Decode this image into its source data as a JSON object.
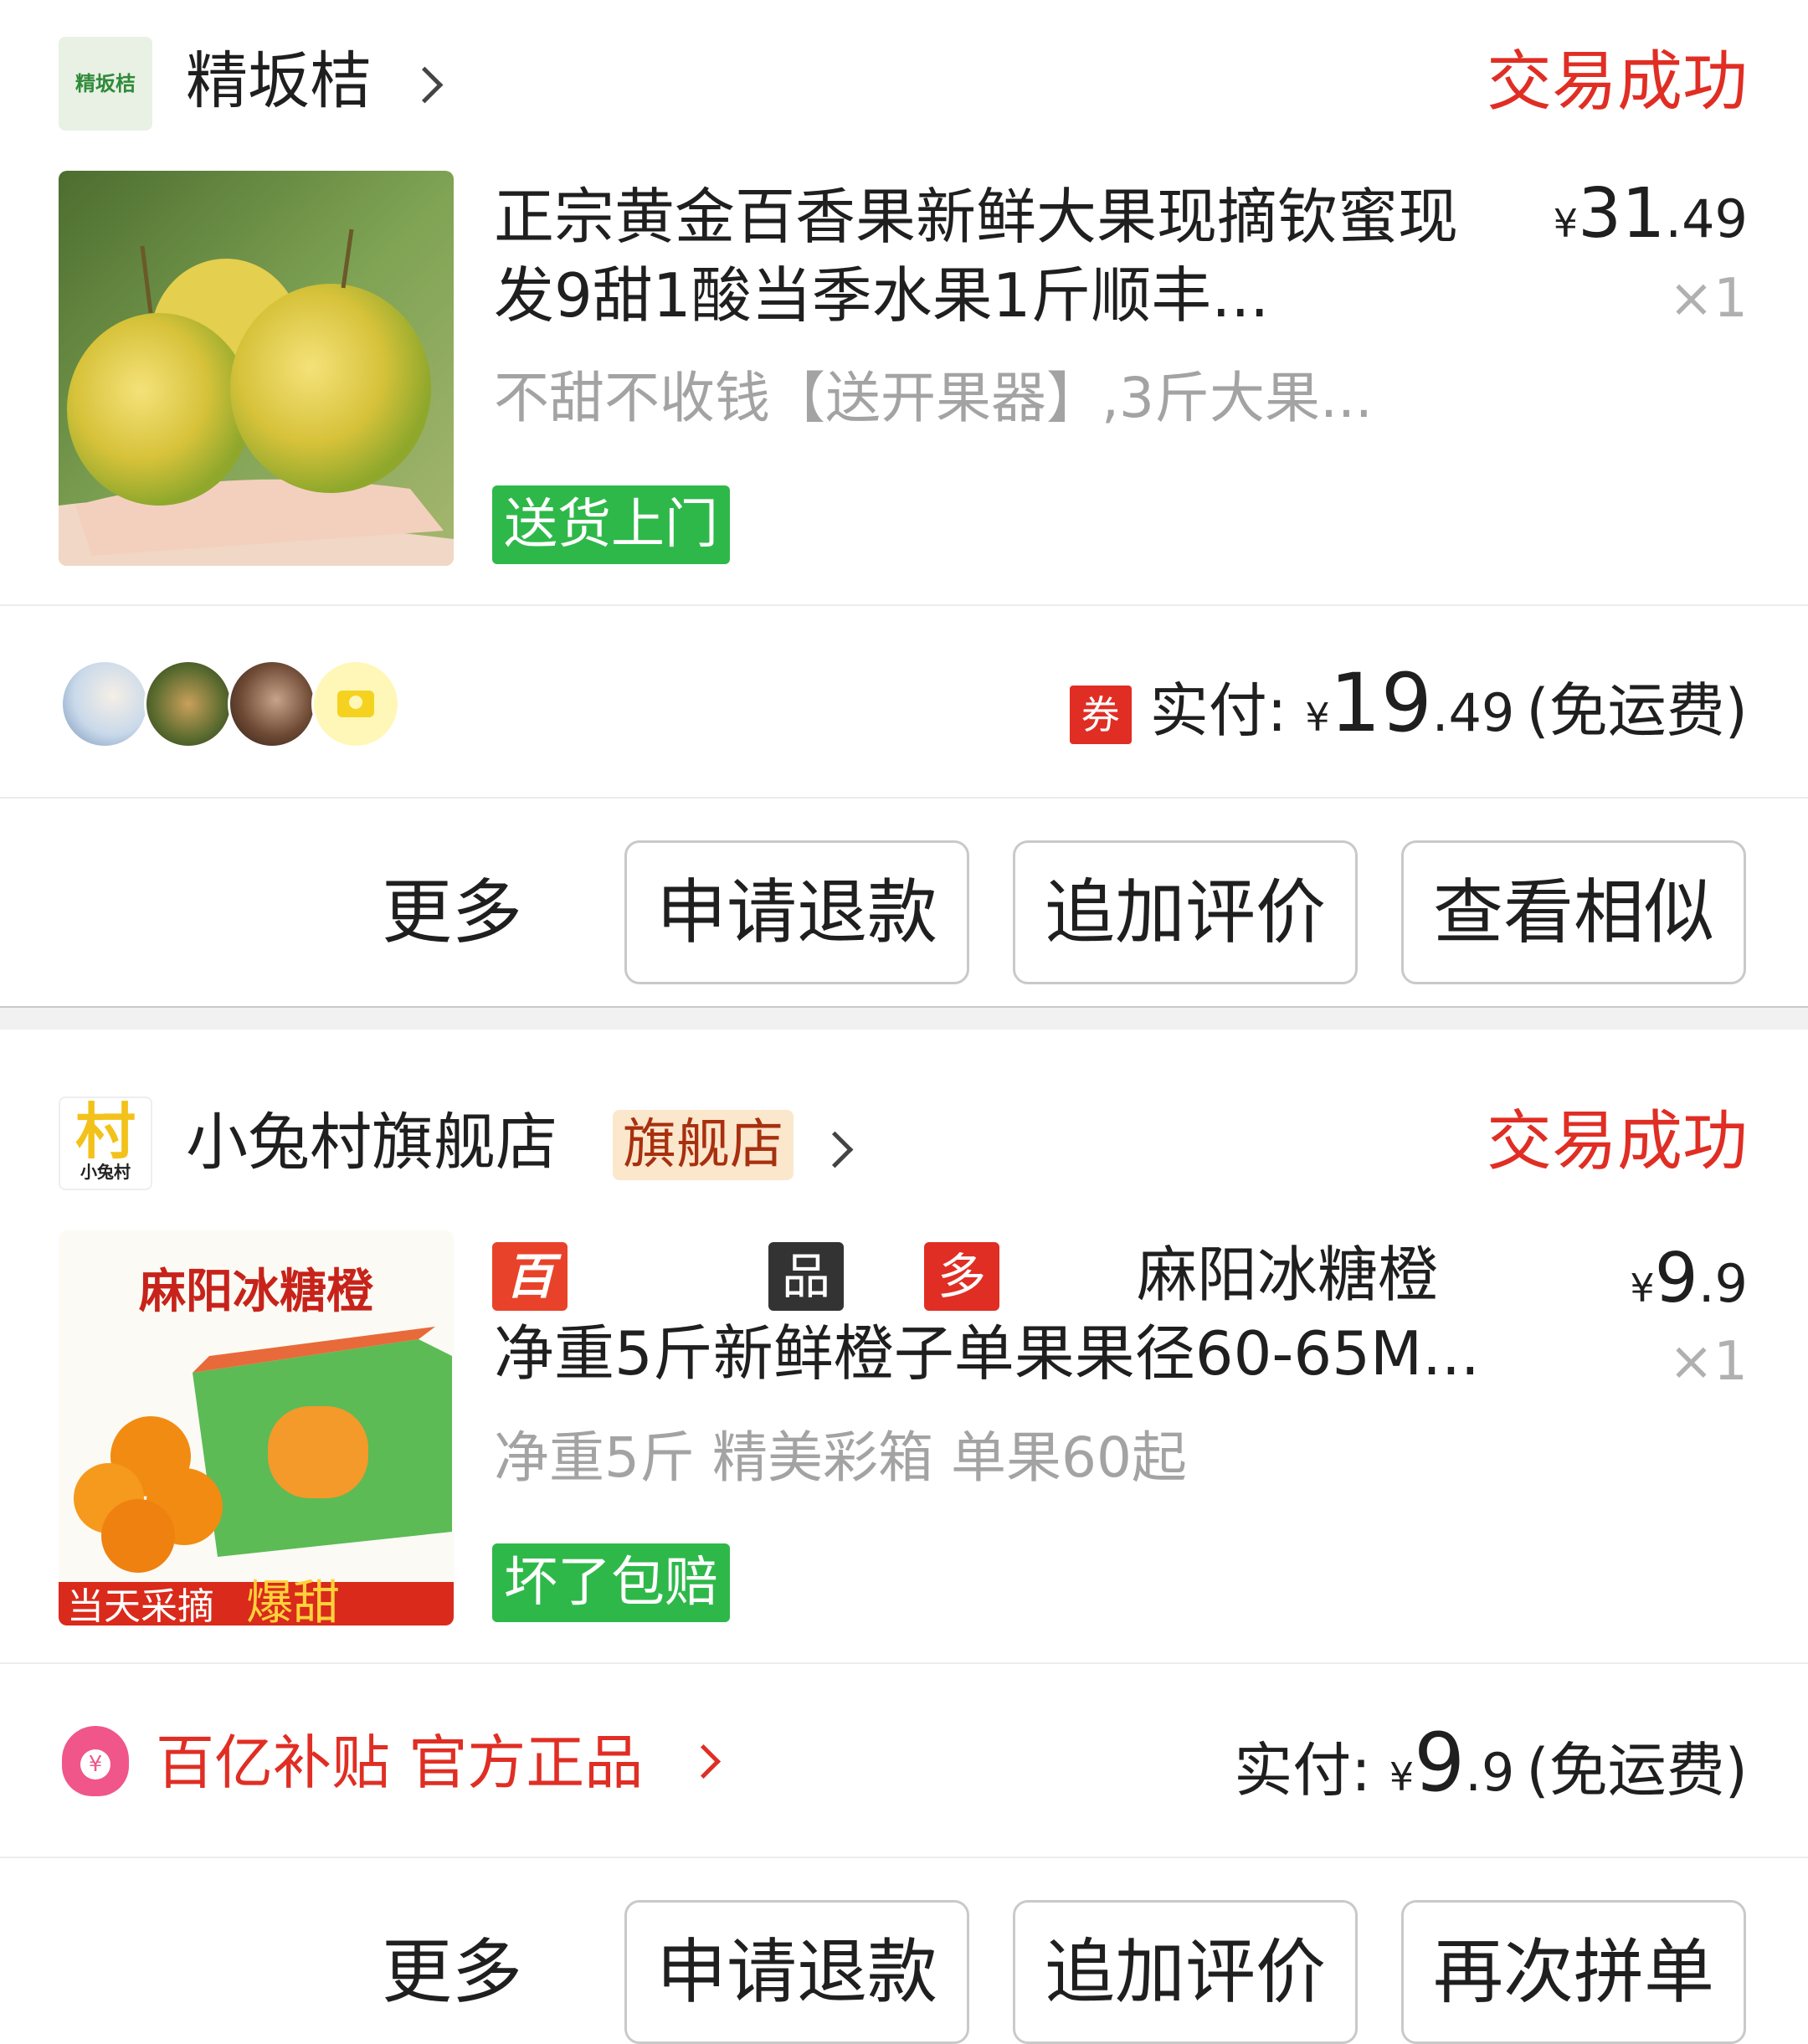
{
  "orders": [
    {
      "shop_name": "精坂桔",
      "shop_logo_text": "精坂桔",
      "status": "交易成功",
      "product_title": "正宗黄金百香果新鲜大果现摘钦蜜现发9甜1酸当季水果1斤顺丰...",
      "spec": "不甜不收钱【送开果器】,3斤大果...",
      "service_tag": "送货上门",
      "price_symbol": "¥",
      "price_int": "31",
      "price_dec": ".49",
      "quantity": "×1",
      "coupon_badge": "券",
      "paid_label": "实付:",
      "paid_symbol": "¥",
      "paid_int": "19",
      "paid_dec": ".49",
      "shipping_note": "(免运费)",
      "actions": {
        "more": "更多",
        "btn1": "申请退款",
        "btn2": "追加评价",
        "btn3": "查看相似"
      }
    },
    {
      "shop_name": "小兔村旗舰店",
      "shop_badge": "旗舰店",
      "shop_logo_text": "村",
      "shop_logo_sub": "小兔村",
      "status": "交易成功",
      "badges": [
        "百亿补贴",
        "品牌",
        "多人团"
      ],
      "product_title": "麻阳冰糖橙净重5斤新鲜橙子单果果径60-65M...",
      "thumb_text_top": "麻阳冰糖橙",
      "thumb_text_bottom": "当天采摘",
      "thumb_text_bottom2": "爆甜",
      "spec": "净重5斤 精美彩箱 单果60起",
      "service_tag": "坏了包赔",
      "price_symbol": "¥",
      "price_int": "9",
      "price_dec": ".9",
      "quantity": "×1",
      "subsidy_text": "百亿补贴 官方正品",
      "paid_label": "实付:",
      "paid_symbol": "¥",
      "paid_int": "9",
      "paid_dec": ".9",
      "shipping_note": "(免运费)",
      "actions": {
        "more": "更多",
        "btn1": "申请退款",
        "btn2": "追加评价",
        "btn3": "再次拼单"
      }
    }
  ],
  "colors": {
    "accent_red": "#e02e24",
    "tag_green": "#2fb84a",
    "brand_dark": "#333333"
  }
}
